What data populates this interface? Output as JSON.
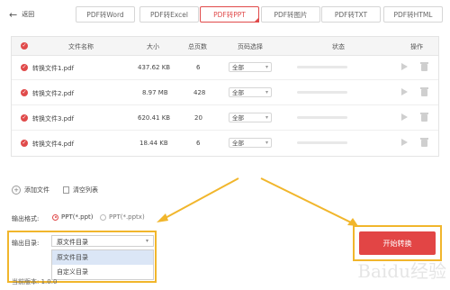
{
  "back": {
    "label": "返回"
  },
  "tabs": [
    {
      "label": "PDF转Word",
      "active": false
    },
    {
      "label": "PDF转Excel",
      "active": false
    },
    {
      "label": "PDF转PPT",
      "active": true
    },
    {
      "label": "PDF转图片",
      "active": false
    },
    {
      "label": "PDF转TXT",
      "active": false
    },
    {
      "label": "PDF转HTML",
      "active": false
    }
  ],
  "table": {
    "headers": {
      "name": "文件名称",
      "size": "大小",
      "pages": "总页数",
      "range": "页码选择",
      "status": "状态",
      "actions": "操作"
    },
    "rows": [
      {
        "name": "转换文件1.pdf",
        "size": "437.62 KB",
        "pages": "6",
        "range": "全部"
      },
      {
        "name": "转换文件2.pdf",
        "size": "8.97 MB",
        "pages": "428",
        "range": "全部"
      },
      {
        "name": "转换文件3.pdf",
        "size": "620.41 KB",
        "pages": "20",
        "range": "全部"
      },
      {
        "name": "转换文件4.pdf",
        "size": "18.44 KB",
        "pages": "6",
        "range": "全部"
      }
    ]
  },
  "file_actions": {
    "add": "添加文件",
    "clear": "清空列表"
  },
  "output_format": {
    "label": "输出格式:",
    "options": [
      {
        "label": "PPT(*.ppt)",
        "selected": true
      },
      {
        "label": "PPT(*.pptx)",
        "selected": false
      }
    ]
  },
  "output_dir": {
    "label": "输出目录:",
    "selected": "原文件目录",
    "options": [
      "原文件目录",
      "自定义目录"
    ]
  },
  "start_button": {
    "label": "开始转换"
  },
  "version": {
    "label": "当前版本: 1.0.0"
  },
  "watermark": "Baidu经验",
  "colors": {
    "accent": "#e04a4a",
    "highlight": "#f1b62c"
  }
}
